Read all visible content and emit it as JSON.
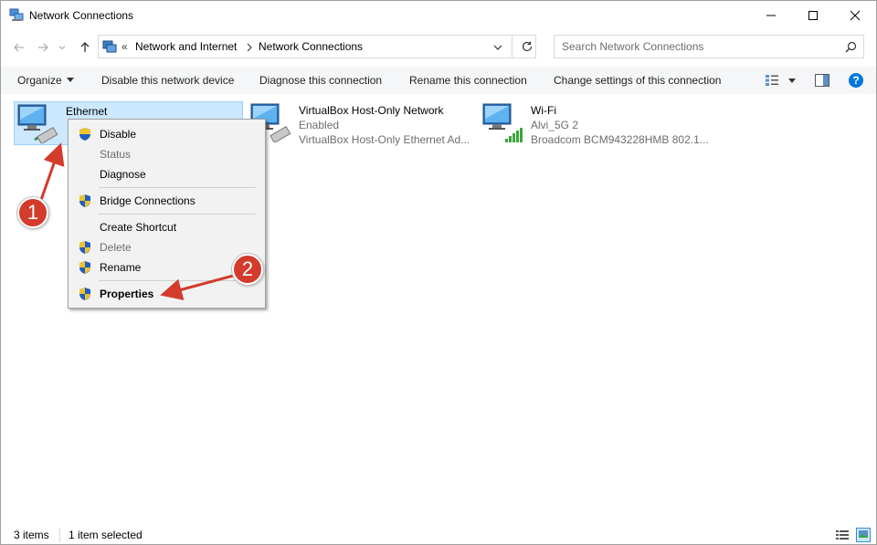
{
  "window": {
    "title": "Network Connections"
  },
  "address": {
    "overflow": "«",
    "crumbs": [
      "Network and Internet",
      "Network Connections"
    ]
  },
  "search": {
    "placeholder": "Search Network Connections"
  },
  "toolbar": {
    "organize": "Organize",
    "disable": "Disable this network device",
    "diagnose": "Diagnose this connection",
    "rename": "Rename this connection",
    "change": "Change settings of this connection"
  },
  "connections": [
    {
      "name": "Ethernet",
      "status": "",
      "device": "",
      "selected": true,
      "icon": "ethernet-adapter-icon"
    },
    {
      "name": "VirtualBox Host-Only Network",
      "status": "Enabled",
      "device": "VirtualBox Host-Only Ethernet Ad...",
      "selected": false,
      "icon": "ethernet-adapter-icon"
    },
    {
      "name": "Wi-Fi",
      "status": "Alvi_5G 2",
      "device": "Broadcom BCM943228HMB 802.1...",
      "selected": false,
      "icon": "wifi-adapter-icon"
    }
  ],
  "context_menu": {
    "items": [
      {
        "label": "Disable",
        "shield": true,
        "disabled": false,
        "bold": false
      },
      {
        "label": "Status",
        "shield": false,
        "disabled": true,
        "bold": false
      },
      {
        "label": "Diagnose",
        "shield": false,
        "disabled": false,
        "bold": false
      },
      {
        "label": "Bridge Connections",
        "shield": true,
        "disabled": false,
        "bold": false
      },
      {
        "label": "Create Shortcut",
        "shield": false,
        "disabled": false,
        "bold": false
      },
      {
        "label": "Delete",
        "shield": true,
        "disabled": true,
        "bold": false
      },
      {
        "label": "Rename",
        "shield": true,
        "disabled": false,
        "bold": false
      },
      {
        "label": "Properties",
        "shield": true,
        "disabled": false,
        "bold": true
      }
    ]
  },
  "annotations": [
    {
      "number": "1"
    },
    {
      "number": "2"
    }
  ],
  "status": {
    "items": "3 items",
    "selected": "1 item selected"
  },
  "colors": {
    "accent": "#0078d7",
    "selection": "#cce8ff",
    "annotation": "#d33b2c"
  }
}
